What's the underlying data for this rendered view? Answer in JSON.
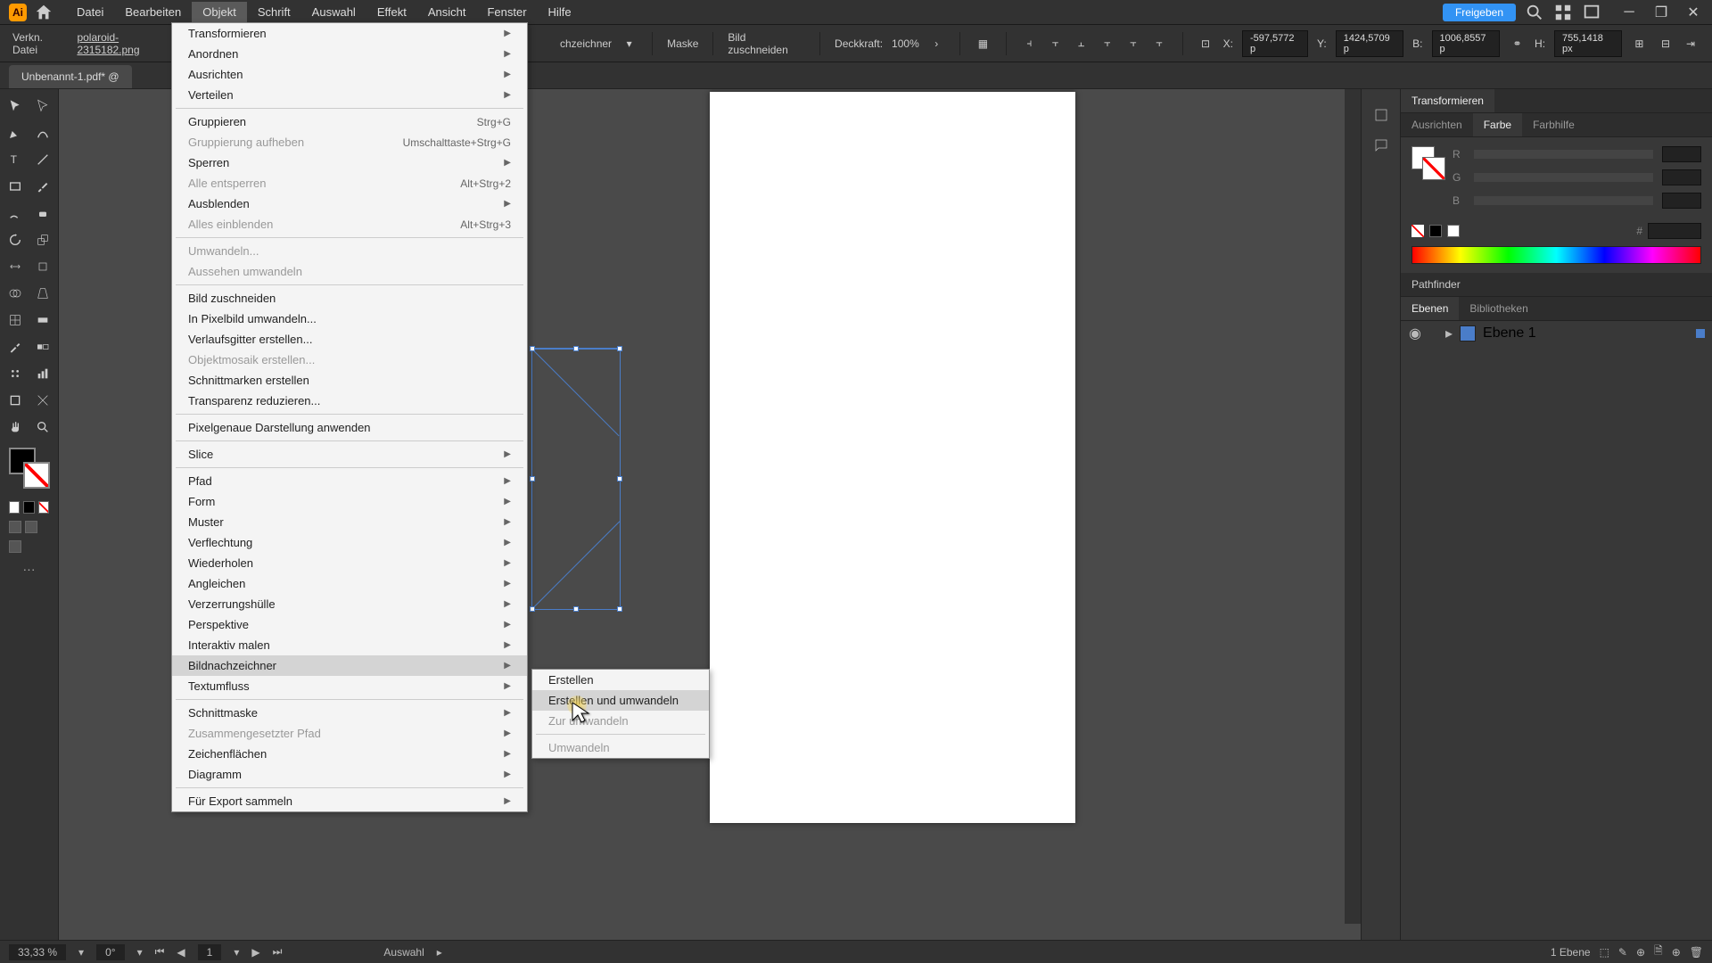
{
  "menubar": {
    "items": [
      "Datei",
      "Bearbeiten",
      "Objekt",
      "Schrift",
      "Auswahl",
      "Effekt",
      "Ansicht",
      "Fenster",
      "Hilfe"
    ],
    "share": "Freigeben"
  },
  "controlbar": {
    "link_label": "Verkn. Datei",
    "filename": "polaroid-2315182.png",
    "mask": "Maske",
    "crop": "Bild zuschneiden",
    "opacity_label": "Deckkraft:",
    "opacity_value": "100%",
    "x_label": "X:",
    "x_value": "-597,5772 p",
    "y_label": "Y:",
    "y_value": "1424,5709 p",
    "w_label": "B:",
    "w_value": "1006,8557 p",
    "h_label": "H:",
    "h_value": "755,1418 px",
    "trace_suffix": "chzeichner"
  },
  "tab": {
    "title": "Unbenannt-1.pdf* @"
  },
  "object_menu": {
    "items": [
      {
        "label": "Transformieren",
        "arrow": true
      },
      {
        "label": "Anordnen",
        "arrow": true
      },
      {
        "label": "Ausrichten",
        "arrow": true
      },
      {
        "label": "Verteilen",
        "arrow": true
      },
      {
        "sep": true
      },
      {
        "label": "Gruppieren",
        "shortcut": "Strg+G"
      },
      {
        "label": "Gruppierung aufheben",
        "shortcut": "Umschalttaste+Strg+G",
        "disabled": true
      },
      {
        "label": "Sperren",
        "arrow": true
      },
      {
        "label": "Alle entsperren",
        "shortcut": "Alt+Strg+2",
        "disabled": true
      },
      {
        "label": "Ausblenden",
        "arrow": true
      },
      {
        "label": "Alles einblenden",
        "shortcut": "Alt+Strg+3",
        "disabled": true
      },
      {
        "sep": true
      },
      {
        "label": "Umwandeln...",
        "disabled": true
      },
      {
        "label": "Aussehen umwandeln",
        "disabled": true
      },
      {
        "sep": true
      },
      {
        "label": "Bild zuschneiden"
      },
      {
        "label": "In Pixelbild umwandeln..."
      },
      {
        "label": "Verlaufsgitter erstellen..."
      },
      {
        "label": "Objektmosaik erstellen...",
        "disabled": true
      },
      {
        "label": "Schnittmarken erstellen"
      },
      {
        "label": "Transparenz reduzieren..."
      },
      {
        "sep": true
      },
      {
        "label": "Pixelgenaue Darstellung anwenden"
      },
      {
        "sep": true
      },
      {
        "label": "Slice",
        "arrow": true
      },
      {
        "sep": true
      },
      {
        "label": "Pfad",
        "arrow": true
      },
      {
        "label": "Form",
        "arrow": true
      },
      {
        "label": "Muster",
        "arrow": true
      },
      {
        "label": "Verflechtung",
        "arrow": true
      },
      {
        "label": "Wiederholen",
        "arrow": true
      },
      {
        "label": "Angleichen",
        "arrow": true
      },
      {
        "label": "Verzerrungshülle",
        "arrow": true
      },
      {
        "label": "Perspektive",
        "arrow": true
      },
      {
        "label": "Interaktiv malen",
        "arrow": true
      },
      {
        "label": "Bildnachzeichner",
        "arrow": true,
        "hover": true
      },
      {
        "label": "Textumfluss",
        "arrow": true
      },
      {
        "sep": true
      },
      {
        "label": "Schnittmaske",
        "arrow": true
      },
      {
        "label": "Zusammengesetzter Pfad",
        "arrow": true,
        "disabled": true
      },
      {
        "label": "Zeichenflächen",
        "arrow": true
      },
      {
        "label": "Diagramm",
        "arrow": true
      },
      {
        "sep": true
      },
      {
        "label": "Für Export sammeln",
        "arrow": true
      }
    ]
  },
  "submenu": {
    "items": [
      {
        "label": "Erstellen"
      },
      {
        "label": "Erstellen und umwandeln",
        "hover": true
      },
      {
        "label": "Zur umwandeln",
        "disabled": true
      },
      {
        "sep": true
      },
      {
        "label": "Umwandeln",
        "disabled": true
      }
    ]
  },
  "right": {
    "transform_tab": "Transformieren",
    "tabs2": [
      "Ausrichten",
      "Farbe",
      "Farbhilfe"
    ],
    "r": "R",
    "g": "G",
    "b": "B",
    "pathfinder": "Pathfinder",
    "tabs3": [
      "Ebenen",
      "Bibliotheken"
    ],
    "layer_name": "Ebene 1"
  },
  "status": {
    "zoom": "33,33 %",
    "rotate": "0°",
    "page": "1",
    "tool": "Auswahl",
    "layers": "1 Ebene"
  }
}
